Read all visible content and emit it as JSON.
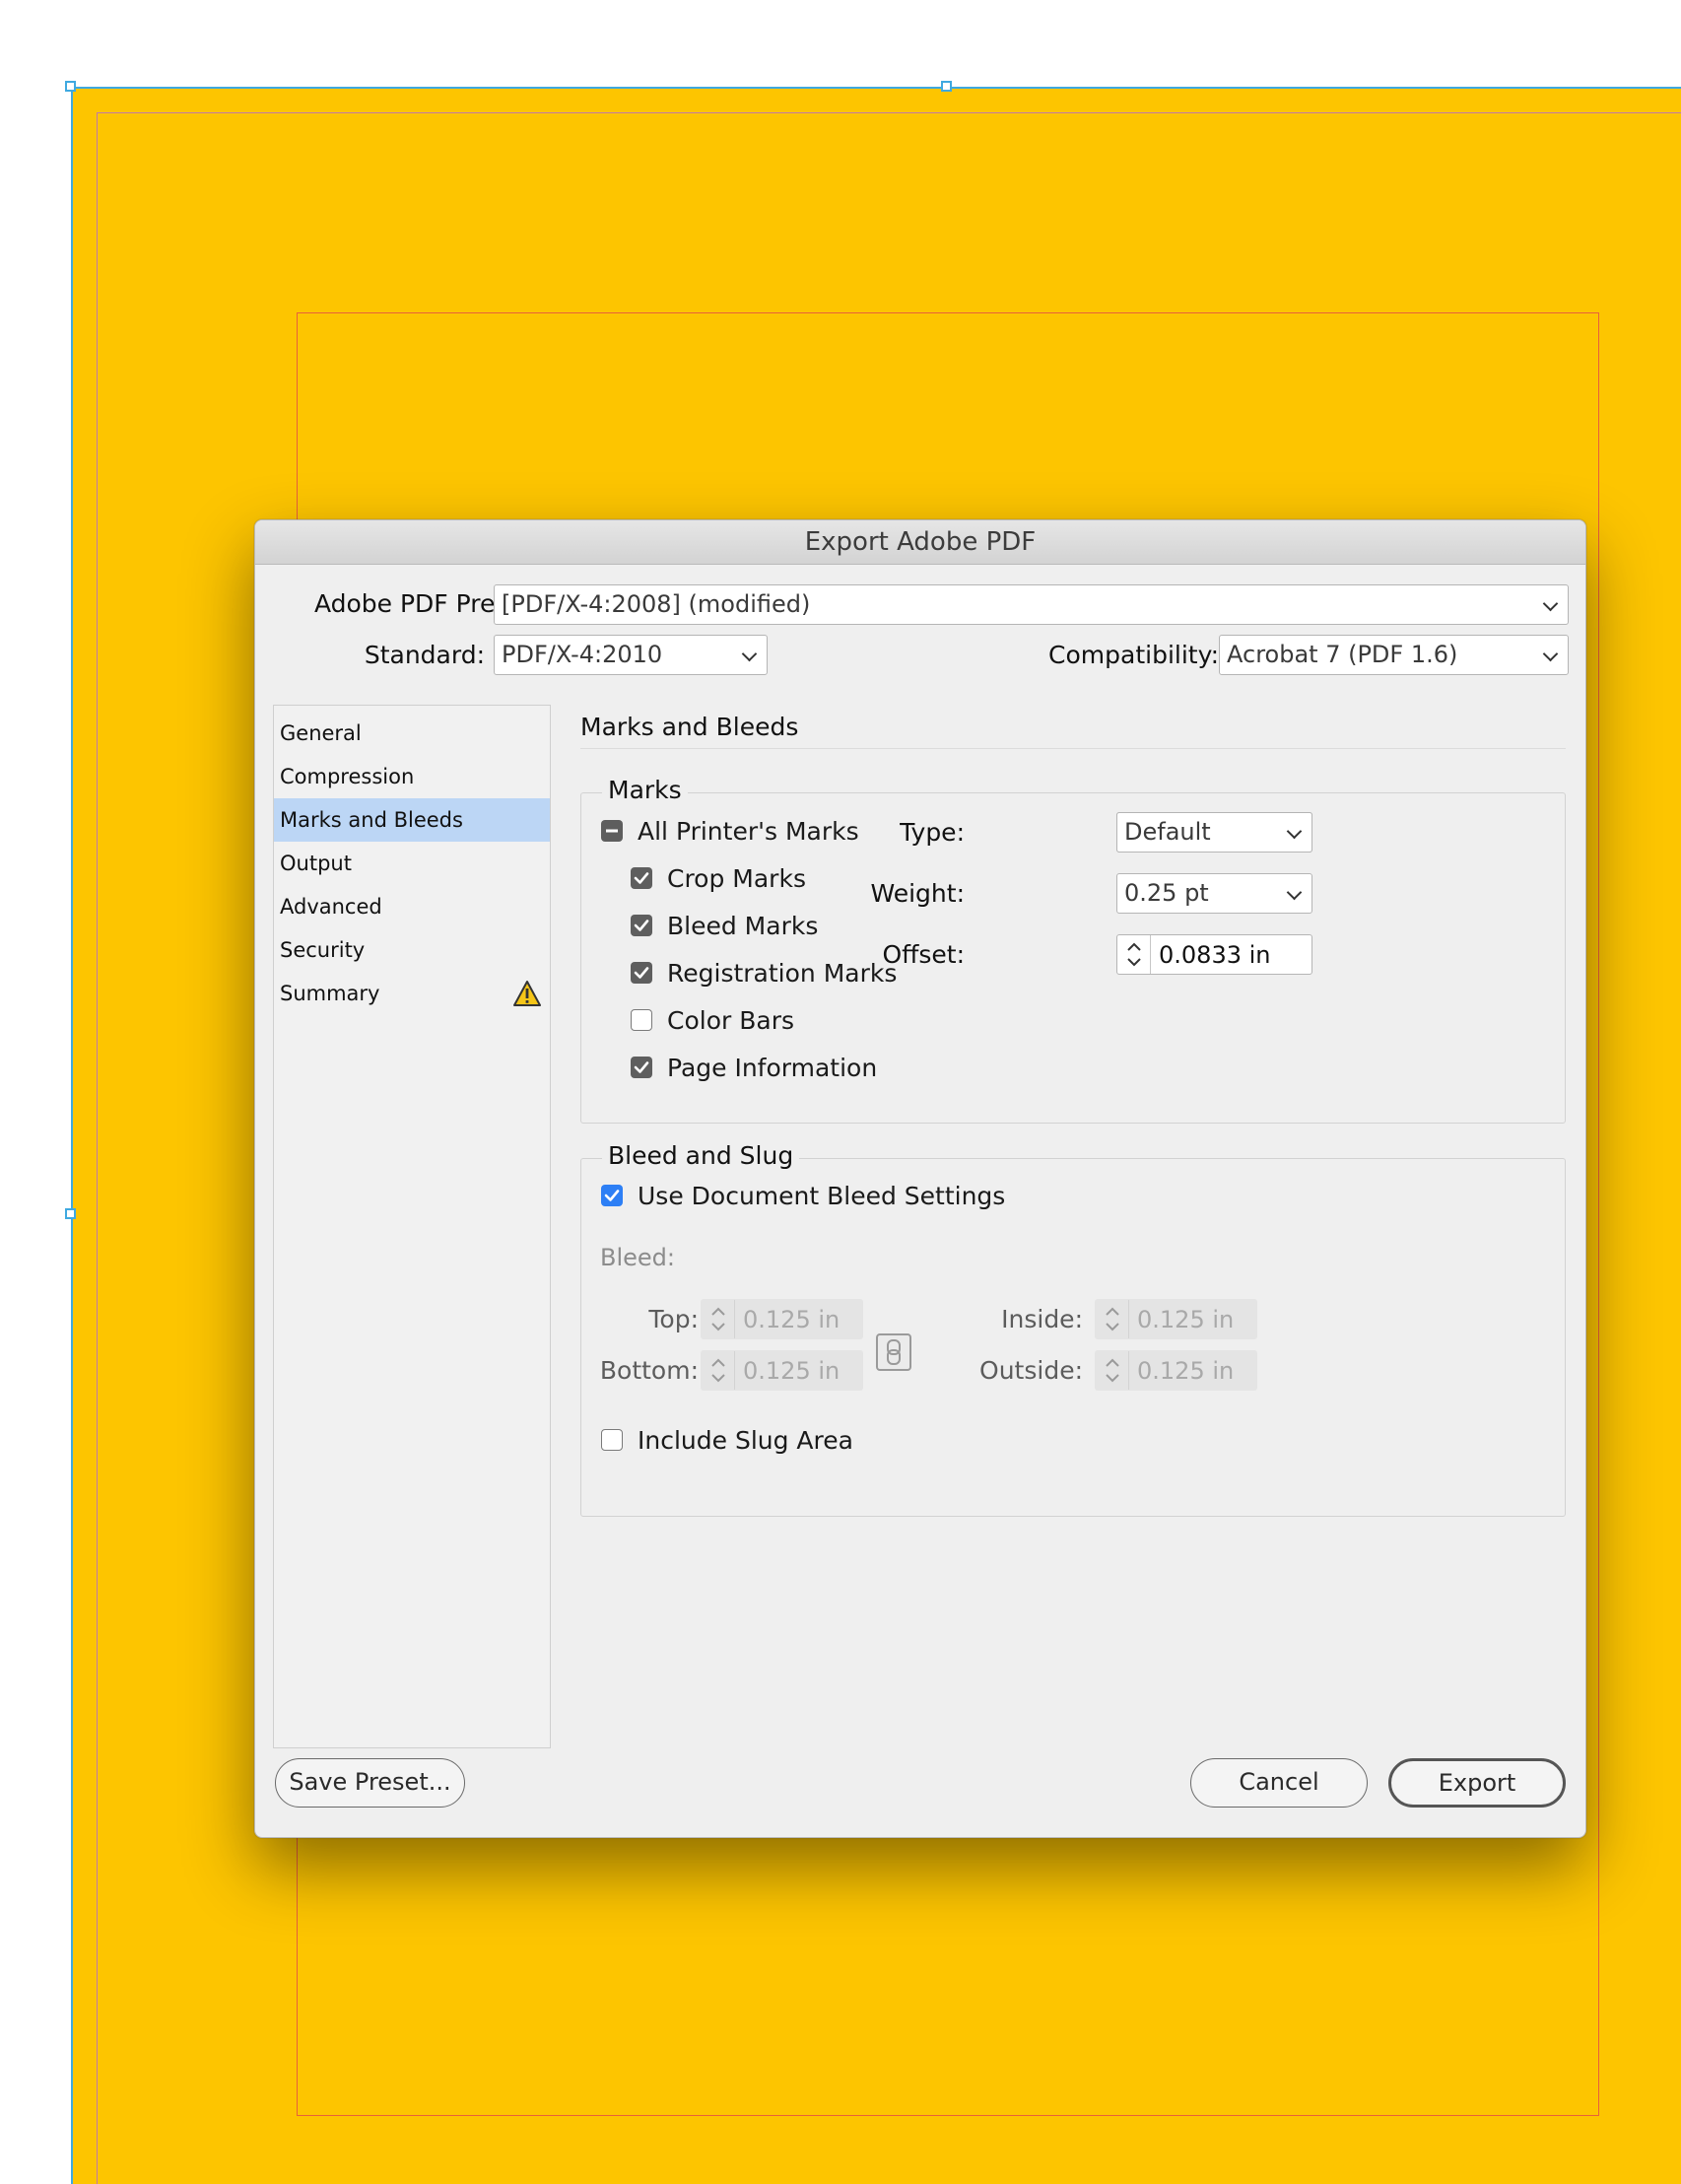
{
  "dialog": {
    "title": "Export Adobe PDF",
    "preset_label": "Adobe PDF Preset:",
    "preset_value": "[PDF/X-4:2008] (modified)",
    "standard_label": "Standard:",
    "standard_value": "PDF/X-4:2010",
    "compat_label": "Compatibility:",
    "compat_value": "Acrobat 7 (PDF 1.6)"
  },
  "sidebar": {
    "items": [
      {
        "label": "General"
      },
      {
        "label": "Compression"
      },
      {
        "label": "Marks and Bleeds",
        "selected": true
      },
      {
        "label": "Output"
      },
      {
        "label": "Advanced"
      },
      {
        "label": "Security"
      },
      {
        "label": "Summary",
        "warning": true
      }
    ]
  },
  "panel": {
    "title": "Marks and Bleeds",
    "marks": {
      "group_title": "Marks",
      "all_printers_marks": "All Printer's Marks",
      "items": [
        {
          "label": "Crop Marks",
          "checked": true
        },
        {
          "label": "Bleed Marks",
          "checked": true
        },
        {
          "label": "Registration Marks",
          "checked": true
        },
        {
          "label": "Color Bars",
          "checked": false
        },
        {
          "label": "Page Information",
          "checked": true
        }
      ],
      "type_label": "Type:",
      "type_value": "Default",
      "weight_label": "Weight:",
      "weight_value": "0.25 pt",
      "offset_label": "Offset:",
      "offset_value": "0.0833 in"
    },
    "bleed": {
      "group_title": "Bleed and Slug",
      "use_doc_bleed": "Use Document Bleed Settings",
      "bleed_label": "Bleed:",
      "top_label": "Top:",
      "top_value": "0.125 in",
      "bottom_label": "Bottom:",
      "bottom_value": "0.125 in",
      "inside_label": "Inside:",
      "inside_value": "0.125 in",
      "outside_label": "Outside:",
      "outside_value": "0.125 in",
      "include_slug": "Include Slug Area"
    }
  },
  "buttons": {
    "save_preset": "Save Preset...",
    "cancel": "Cancel",
    "export": "Export"
  },
  "colors": {
    "page": "#fdc500",
    "selection": "#bcd6f5",
    "accent": "#2d7ff5"
  }
}
